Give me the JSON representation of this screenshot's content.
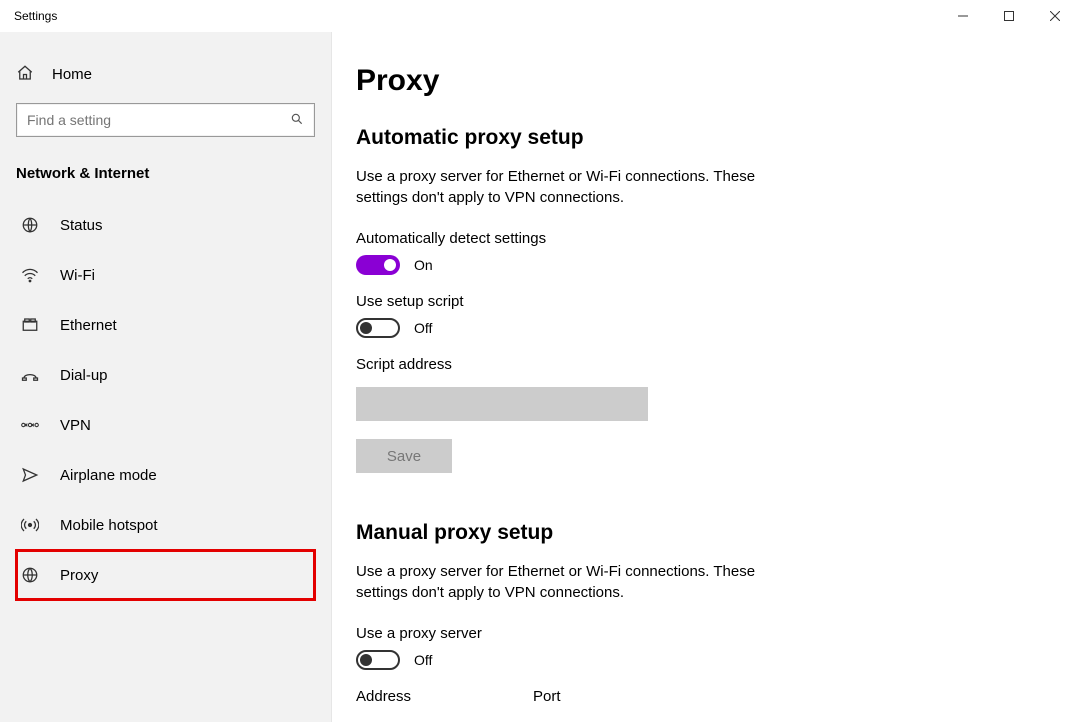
{
  "window": {
    "title": "Settings"
  },
  "sidebar": {
    "home": "Home",
    "search_placeholder": "Find a setting",
    "category": "Network & Internet",
    "items": [
      {
        "label": "Status",
        "icon": "status"
      },
      {
        "label": "Wi-Fi",
        "icon": "wifi"
      },
      {
        "label": "Ethernet",
        "icon": "ethernet"
      },
      {
        "label": "Dial-up",
        "icon": "dialup"
      },
      {
        "label": "VPN",
        "icon": "vpn"
      },
      {
        "label": "Airplane mode",
        "icon": "airplane"
      },
      {
        "label": "Mobile hotspot",
        "icon": "hotspot"
      },
      {
        "label": "Proxy",
        "icon": "globe",
        "highlight": true
      }
    ]
  },
  "main": {
    "page_title": "Proxy",
    "auto": {
      "title": "Automatic proxy setup",
      "desc": "Use a proxy server for Ethernet or Wi-Fi connections. These settings don't apply to VPN connections.",
      "detect_label": "Automatically detect settings",
      "detect_state": "On",
      "script_toggle_label": "Use setup script",
      "script_state": "Off",
      "script_address_label": "Script address",
      "save_label": "Save"
    },
    "manual": {
      "title": "Manual proxy setup",
      "desc": "Use a proxy server for Ethernet or Wi-Fi connections. These settings don't apply to VPN connections.",
      "use_proxy_label": "Use a proxy server",
      "use_proxy_state": "Off",
      "address_label": "Address",
      "port_label": "Port"
    }
  }
}
